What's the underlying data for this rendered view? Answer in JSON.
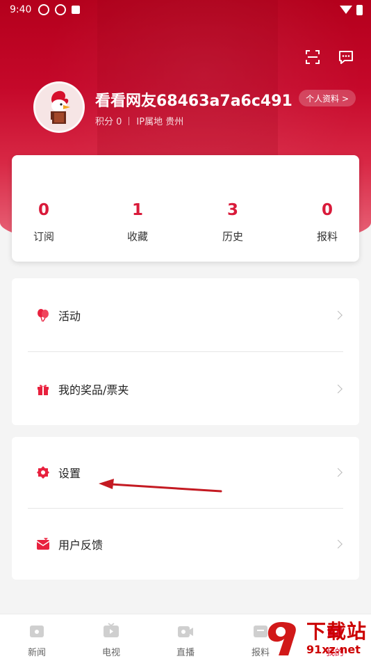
{
  "status_bar": {
    "time": "9:40"
  },
  "profile": {
    "username": "看看网友68463a7a6c491",
    "points_label": "积分 0",
    "ip_label": "IP属地 贵州",
    "profile_button": "个人资料 >"
  },
  "stats": [
    {
      "value": "0",
      "label": "订阅"
    },
    {
      "value": "1",
      "label": "收藏"
    },
    {
      "value": "3",
      "label": "历史"
    },
    {
      "value": "0",
      "label": "报料"
    }
  ],
  "menu_group_1": [
    {
      "label": "活动",
      "icon": "balloon-icon"
    },
    {
      "label": "我的奖品/票夹",
      "icon": "gift-icon"
    }
  ],
  "menu_group_2": [
    {
      "label": "设置",
      "icon": "settings-icon"
    },
    {
      "label": "用户反馈",
      "icon": "feedback-icon"
    }
  ],
  "tabbar": [
    {
      "label": "新闻",
      "icon": "news-icon"
    },
    {
      "label": "电视",
      "icon": "tv-icon"
    },
    {
      "label": "直播",
      "icon": "live-icon"
    },
    {
      "label": "报料",
      "icon": "report-icon"
    },
    {
      "label": "我的",
      "icon": "profile-icon"
    }
  ],
  "watermark": {
    "big": "下载站",
    "small": "91xz.net"
  },
  "colors": {
    "accent": "#d91a3a",
    "header": "#c5082a"
  }
}
